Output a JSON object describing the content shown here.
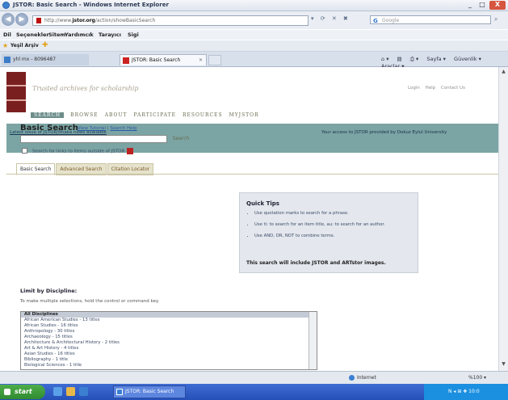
{
  "window": {
    "title": "JSTOR: Basic Search - Windows Internet Explorer",
    "min": "_",
    "max": "□",
    "close": "X"
  },
  "address": {
    "url_prefix": "http://www.",
    "url_domain": "jstor.org",
    "url_suffix": "/action/showBasicSearch",
    "search_placeholder": "Google"
  },
  "menu": [
    "Dil",
    "Seçenekler",
    "Sitem",
    "Yardımcık",
    "Tarayıcı",
    "Sigi"
  ],
  "favorites": {
    "label": "Yeşil Arşiv"
  },
  "tabs": [
    {
      "label": "yhl mx - 8096487"
    },
    {
      "label": "JSTOR: Basic Search"
    }
  ],
  "tabtools": [
    "Sayfa ▾",
    "Güvenlik ▾",
    "Araçlar ▾"
  ],
  "site": {
    "tagline": "Trusted archives for scholarship",
    "toplinks": [
      "Login",
      "Help",
      "Contact Us"
    ],
    "nav": [
      "SEARCH",
      "BROWSE",
      "ABOUT",
      "PARTICIPATE",
      "RESOURCES",
      "MYJSTOR"
    ],
    "issue_link": "Latest issue of JSTOR/Ithaka news available",
    "access_text": "Your access to JSTOR provided by Dokuz Eylul University"
  },
  "subtabs": [
    "Basic Search",
    "Advanced Search",
    "Citation Locator"
  ],
  "basic": {
    "title": "Basic Search",
    "help_links": [
      "View Tutorial",
      "Search Help"
    ],
    "search_button": "Search",
    "checkbox_label": "Search for links to items outside of JSTOR"
  },
  "tips": {
    "title": "Quick Tips",
    "items": [
      "Use quotation marks to search for a phrase.",
      "Use ti: to search for an item title, au: to search for an author.",
      "Use AND, OR, NOT to combine terms."
    ],
    "note": "This search will include JSTOR and ARTstor images."
  },
  "limit": {
    "title": "Limit by Discipline:",
    "hint": "To make multiple selections, hold the control or command key.",
    "options": [
      "All Disciplines",
      "African American Studies - 13 titles",
      "African Studies - 16 titles",
      "Anthropology - 30 titles",
      "Archaeology - 15 titles",
      "Architecture & Architectural History - 2 titles",
      "Art & Art History - 4 titles",
      "Asian Studies - 16 titles",
      "Bibliography - 1 title",
      "Biological Sciences - 1 title"
    ]
  },
  "status": {
    "zone": "Internet",
    "zoom": "%100 ▾"
  },
  "taskbar": {
    "start": "start",
    "item": "JSTOR: Basic Search",
    "tray": "N  ◂ ⊞ ✚ 10:0"
  }
}
